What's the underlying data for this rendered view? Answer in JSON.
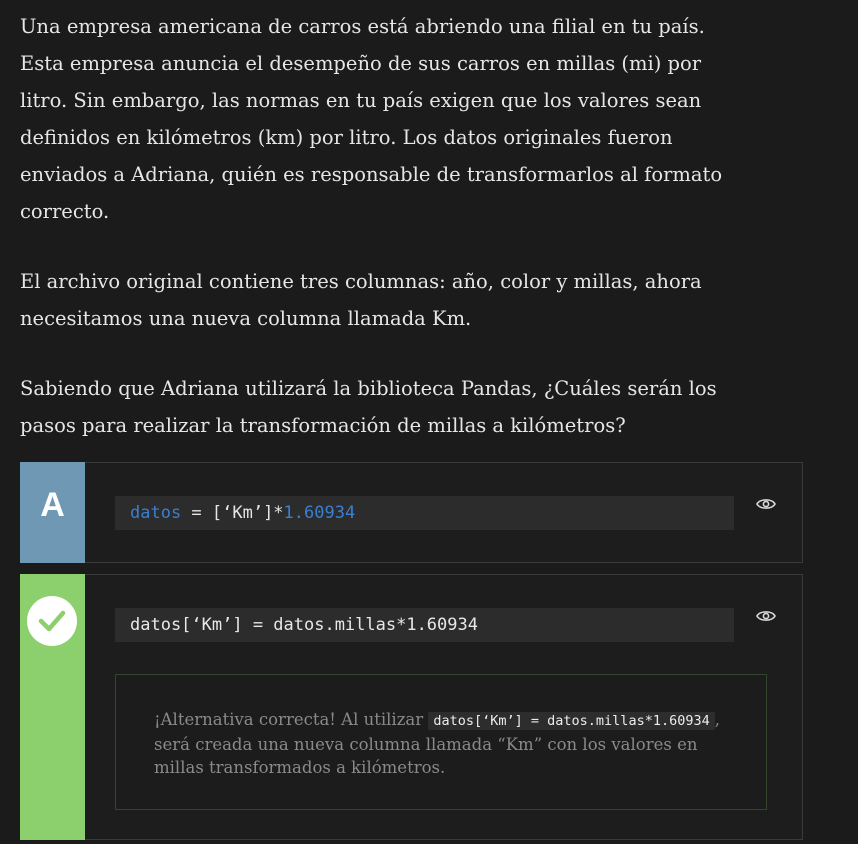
{
  "question": {
    "paragraph_1": "Una empresa americana de carros está abriendo una filial en tu país. Esta empresa anuncia el desempeño de sus carros en millas (mi) por litro. Sin embargo, las normas en tu país exigen que los valores sean definidos en kilómetros (km) por litro. Los datos originales fueron enviados a Adriana, quién es responsable de transformarlos al formato correcto.",
    "paragraph_2": "El archivo original contiene tres columnas: año, color y millas, ahora necesitamos una nueva columna llamada Km.",
    "paragraph_3": "Sabiendo que Adriana utilizará la biblioteca Pandas, ¿Cuáles serán los pasos para realizar la transformación de millas a kilómetros?"
  },
  "alternatives": [
    {
      "letter": "A",
      "code_tokens": {
        "var": "datos",
        "middle": " = [‘Km’]*",
        "num": "1.60934"
      },
      "color": "#6f98b4",
      "icon": "eye-icon"
    },
    {
      "status_icon": "check-icon",
      "code": "datos[‘Km’] = datos.millas*1.60934",
      "color": "#8ccf6d",
      "icon": "eye-icon",
      "feedback": {
        "before": "¡Alternativa correcta! Al utilizar ",
        "code": "datos[‘Km’] = datos.millas*1.60934",
        "after": ", será creada una nueva columna llamada “Km” con los valores en millas transformados a kilómetros."
      }
    }
  ]
}
